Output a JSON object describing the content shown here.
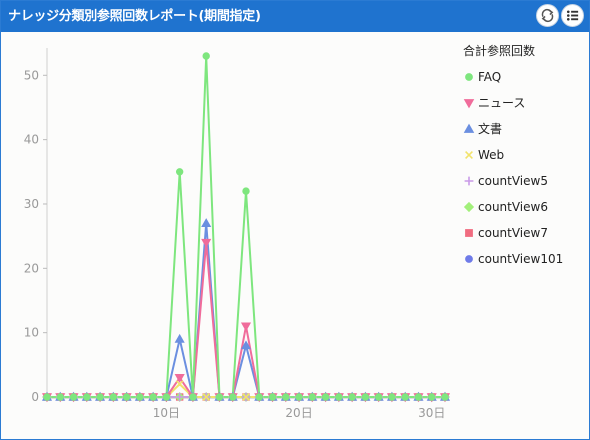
{
  "window": {
    "title": "ナレッジ分類別参照回数レポート(期間指定)",
    "buttons": [
      {
        "name": "refresh-button",
        "icon": "refresh-icon"
      },
      {
        "name": "menu-button",
        "icon": "list-icon"
      }
    ]
  },
  "colors": {
    "titlebar": "#1f73cf",
    "FAQ": "#7ee67e",
    "news": "#f06c9b",
    "doc": "#6b8fe0",
    "web": "#f2e36b",
    "countView5": "#c99ae8",
    "countView6": "#a2f07a",
    "countView7": "#f06c80",
    "countView101": "#6f7be8"
  },
  "chart_data": {
    "type": "line",
    "x_min": 1,
    "x_max": 31,
    "ylim": [
      0,
      53
    ],
    "xticks": [
      10,
      20,
      30
    ],
    "xtick_labels": [
      "10日",
      "20日",
      "30日"
    ],
    "yticks": [
      0,
      10,
      20,
      30,
      40,
      50
    ],
    "legend_title": "合計参照回数",
    "legend_position": "right",
    "series": [
      {
        "name": "FAQ",
        "marker": "circle",
        "color": "#7ee67e",
        "points": [
          [
            1,
            0
          ],
          [
            2,
            0
          ],
          [
            3,
            0
          ],
          [
            4,
            0
          ],
          [
            5,
            0
          ],
          [
            6,
            0
          ],
          [
            7,
            0
          ],
          [
            8,
            0
          ],
          [
            9,
            0
          ],
          [
            10,
            0
          ],
          [
            11,
            35
          ],
          [
            12,
            0
          ],
          [
            13,
            53
          ],
          [
            14,
            0
          ],
          [
            15,
            0
          ],
          [
            16,
            32
          ],
          [
            17,
            0
          ],
          [
            18,
            0
          ],
          [
            19,
            0
          ],
          [
            20,
            0
          ],
          [
            21,
            0
          ],
          [
            22,
            0
          ],
          [
            23,
            0
          ],
          [
            24,
            0
          ],
          [
            25,
            0
          ],
          [
            26,
            0
          ],
          [
            27,
            0
          ],
          [
            28,
            0
          ],
          [
            29,
            0
          ],
          [
            30,
            0
          ],
          [
            31,
            0
          ]
        ]
      },
      {
        "name": "ニュース",
        "marker": "triangle-down",
        "color": "#f06c9b",
        "points": [
          [
            1,
            0
          ],
          [
            2,
            0
          ],
          [
            3,
            0
          ],
          [
            4,
            0
          ],
          [
            5,
            0
          ],
          [
            6,
            0
          ],
          [
            7,
            0
          ],
          [
            8,
            0
          ],
          [
            9,
            0
          ],
          [
            10,
            0
          ],
          [
            11,
            3
          ],
          [
            12,
            0
          ],
          [
            13,
            24
          ],
          [
            14,
            0
          ],
          [
            15,
            0
          ],
          [
            16,
            11
          ],
          [
            17,
            0
          ],
          [
            18,
            0
          ],
          [
            19,
            0
          ],
          [
            20,
            0
          ],
          [
            21,
            0
          ],
          [
            22,
            0
          ],
          [
            23,
            0
          ],
          [
            24,
            0
          ],
          [
            25,
            0
          ],
          [
            26,
            0
          ],
          [
            27,
            0
          ],
          [
            28,
            0
          ],
          [
            29,
            0
          ],
          [
            30,
            0
          ],
          [
            31,
            0
          ]
        ]
      },
      {
        "name": "文書",
        "marker": "triangle",
        "color": "#6b8fe0",
        "points": [
          [
            1,
            0
          ],
          [
            2,
            0
          ],
          [
            3,
            0
          ],
          [
            4,
            0
          ],
          [
            5,
            0
          ],
          [
            6,
            0
          ],
          [
            7,
            0
          ],
          [
            8,
            0
          ],
          [
            9,
            0
          ],
          [
            10,
            0
          ],
          [
            11,
            9
          ],
          [
            12,
            0
          ],
          [
            13,
            27
          ],
          [
            14,
            0
          ],
          [
            15,
            0
          ],
          [
            16,
            8
          ],
          [
            17,
            0
          ],
          [
            18,
            0
          ],
          [
            19,
            0
          ],
          [
            20,
            0
          ],
          [
            21,
            0
          ],
          [
            22,
            0
          ],
          [
            23,
            0
          ],
          [
            24,
            0
          ],
          [
            25,
            0
          ],
          [
            26,
            0
          ],
          [
            27,
            0
          ],
          [
            28,
            0
          ],
          [
            29,
            0
          ],
          [
            30,
            0
          ],
          [
            31,
            0
          ]
        ]
      },
      {
        "name": "Web",
        "marker": "cross",
        "color": "#f2e36b",
        "points": [
          [
            1,
            0
          ],
          [
            2,
            0
          ],
          [
            3,
            0
          ],
          [
            4,
            0
          ],
          [
            5,
            0
          ],
          [
            6,
            0
          ],
          [
            7,
            0
          ],
          [
            8,
            0
          ],
          [
            9,
            0
          ],
          [
            10,
            0
          ],
          [
            11,
            2
          ],
          [
            12,
            0
          ],
          [
            13,
            0
          ],
          [
            14,
            0
          ],
          [
            15,
            0
          ],
          [
            16,
            0
          ],
          [
            17,
            0
          ],
          [
            18,
            0
          ],
          [
            19,
            0
          ],
          [
            20,
            0
          ],
          [
            21,
            0
          ],
          [
            22,
            0
          ],
          [
            23,
            0
          ],
          [
            24,
            0
          ],
          [
            25,
            0
          ],
          [
            26,
            0
          ],
          [
            27,
            0
          ],
          [
            28,
            0
          ],
          [
            29,
            0
          ],
          [
            30,
            0
          ],
          [
            31,
            0
          ]
        ]
      },
      {
        "name": "countView5",
        "marker": "plus",
        "color": "#c99ae8",
        "points": [
          [
            1,
            0
          ],
          [
            2,
            0
          ],
          [
            3,
            0
          ],
          [
            4,
            0
          ],
          [
            5,
            0
          ],
          [
            6,
            0
          ],
          [
            7,
            0
          ],
          [
            8,
            0
          ],
          [
            9,
            0
          ],
          [
            10,
            0
          ],
          [
            11,
            0
          ],
          [
            12,
            0
          ],
          [
            13,
            0
          ],
          [
            14,
            0
          ],
          [
            15,
            0
          ],
          [
            16,
            0
          ],
          [
            17,
            0
          ],
          [
            18,
            0
          ],
          [
            19,
            0
          ],
          [
            20,
            0
          ],
          [
            21,
            0
          ],
          [
            22,
            0
          ],
          [
            23,
            0
          ],
          [
            24,
            0
          ],
          [
            25,
            0
          ],
          [
            26,
            0
          ],
          [
            27,
            0
          ],
          [
            28,
            0
          ],
          [
            29,
            0
          ],
          [
            30,
            0
          ],
          [
            31,
            0
          ]
        ]
      },
      {
        "name": "countView6",
        "marker": "diamond",
        "color": "#a2f07a",
        "points": [
          [
            1,
            0
          ],
          [
            2,
            0
          ],
          [
            3,
            0
          ],
          [
            4,
            0
          ],
          [
            5,
            0
          ],
          [
            6,
            0
          ],
          [
            7,
            0
          ],
          [
            8,
            0
          ],
          [
            9,
            0
          ],
          [
            10,
            0
          ],
          [
            11,
            0
          ],
          [
            12,
            0
          ],
          [
            13,
            0
          ],
          [
            14,
            0
          ],
          [
            15,
            0
          ],
          [
            16,
            0
          ],
          [
            17,
            0
          ],
          [
            18,
            0
          ],
          [
            19,
            0
          ],
          [
            20,
            0
          ],
          [
            21,
            0
          ],
          [
            22,
            0
          ],
          [
            23,
            0
          ],
          [
            24,
            0
          ],
          [
            25,
            0
          ],
          [
            26,
            0
          ],
          [
            27,
            0
          ],
          [
            28,
            0
          ],
          [
            29,
            0
          ],
          [
            30,
            0
          ],
          [
            31,
            0
          ]
        ]
      },
      {
        "name": "countView7",
        "marker": "square",
        "color": "#f06c80",
        "points": [
          [
            1,
            0
          ],
          [
            2,
            0
          ],
          [
            3,
            0
          ],
          [
            4,
            0
          ],
          [
            5,
            0
          ],
          [
            6,
            0
          ],
          [
            7,
            0
          ],
          [
            8,
            0
          ],
          [
            9,
            0
          ],
          [
            10,
            0
          ],
          [
            11,
            0
          ],
          [
            12,
            0
          ],
          [
            13,
            0
          ],
          [
            14,
            0
          ],
          [
            15,
            0
          ],
          [
            16,
            0
          ],
          [
            17,
            0
          ],
          [
            18,
            0
          ],
          [
            19,
            0
          ],
          [
            20,
            0
          ],
          [
            21,
            0
          ],
          [
            22,
            0
          ],
          [
            23,
            0
          ],
          [
            24,
            0
          ],
          [
            25,
            0
          ],
          [
            26,
            0
          ],
          [
            27,
            0
          ],
          [
            28,
            0
          ],
          [
            29,
            0
          ],
          [
            30,
            0
          ],
          [
            31,
            0
          ]
        ]
      },
      {
        "name": "countView101",
        "marker": "circle",
        "color": "#6f7be8",
        "points": [
          [
            1,
            0
          ],
          [
            2,
            0
          ],
          [
            3,
            0
          ],
          [
            4,
            0
          ],
          [
            5,
            0
          ],
          [
            6,
            0
          ],
          [
            7,
            0
          ],
          [
            8,
            0
          ],
          [
            9,
            0
          ],
          [
            10,
            0
          ],
          [
            11,
            0
          ],
          [
            12,
            0
          ],
          [
            13,
            0
          ],
          [
            14,
            0
          ],
          [
            15,
            0
          ],
          [
            16,
            0
          ],
          [
            17,
            0
          ],
          [
            18,
            0
          ],
          [
            19,
            0
          ],
          [
            20,
            0
          ],
          [
            21,
            0
          ],
          [
            22,
            0
          ],
          [
            23,
            0
          ],
          [
            24,
            0
          ],
          [
            25,
            0
          ],
          [
            26,
            0
          ],
          [
            27,
            0
          ],
          [
            28,
            0
          ],
          [
            29,
            0
          ],
          [
            30,
            0
          ],
          [
            31,
            0
          ]
        ]
      }
    ]
  }
}
